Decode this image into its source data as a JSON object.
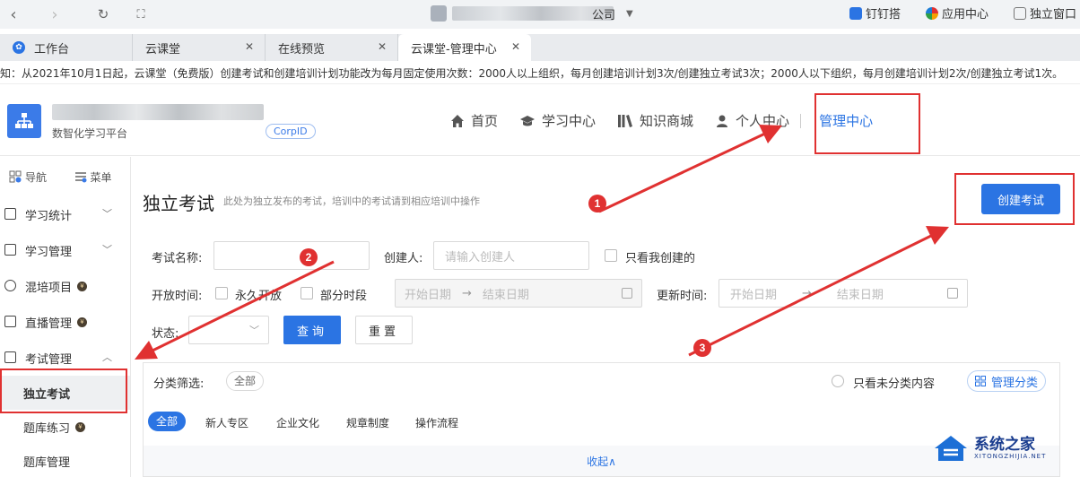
{
  "browser": {
    "address_suffix": "公司",
    "right_items": [
      "钉钉搭",
      "应用中心",
      "独立窗口"
    ]
  },
  "tabs": [
    {
      "label": "工作台"
    },
    {
      "label": "云课堂"
    },
    {
      "label": "在线预览"
    },
    {
      "label": "云课堂-管理中心"
    }
  ],
  "notice": "通知：从2021年10月1日起，云课堂（免费版）创建考试和创建培训计划功能改为每月固定使用次数：2000人以上组织，每月创建培训计划3次/创建独立考试3次；2000人以下组织，每月创建培训计划2次/创建独立考试1次。",
  "header": {
    "org_sub": "数智化学习平台",
    "corpid": "CorpID",
    "nav": [
      "首页",
      "学习中心",
      "知识商城",
      "个人中心"
    ],
    "admin": "管理中心"
  },
  "sidebar": {
    "top": [
      "导航",
      "菜单"
    ],
    "items": [
      {
        "label": "学习统计"
      },
      {
        "label": "学习管理"
      },
      {
        "label": "混培项目"
      },
      {
        "label": "直播管理"
      },
      {
        "label": "考试管理"
      }
    ],
    "subs": [
      "独立考试",
      "题库练习",
      "题库管理"
    ],
    "vip_mark": "¥"
  },
  "main": {
    "title": "独立考试",
    "desc": "此处为独立发布的考试，培训中的考试请到相应培训中操作",
    "create_btn": "创建考试",
    "exam_name_label": "考试名称:",
    "creator_label": "创建人:",
    "creator_placeholder": "请输入创建人",
    "only_mine": "只看我创建的",
    "open_time_label": "开放时间:",
    "forever_open": "永久开放",
    "partial_time": "部分时段",
    "start_date": "开始日期",
    "end_date": "结束日期",
    "update_time_label": "更新时间:",
    "status_label": "状态:",
    "query_btn": "查询",
    "reset_btn": "重置",
    "filter_label": "分类筛选:",
    "filter_all": "全部",
    "only_uncategorized": "只看未分类内容",
    "manage_cat": "管理分类",
    "categories": [
      "全部",
      "新人专区",
      "企业文化",
      "规章制度",
      "操作流程"
    ],
    "collapse": "收起∧"
  },
  "annotations": {
    "markers": [
      "1",
      "2",
      "3"
    ],
    "color": "#e03131"
  },
  "watermark": {
    "title": "系统之家",
    "sub": "XITONGZHIJIA.NET"
  }
}
